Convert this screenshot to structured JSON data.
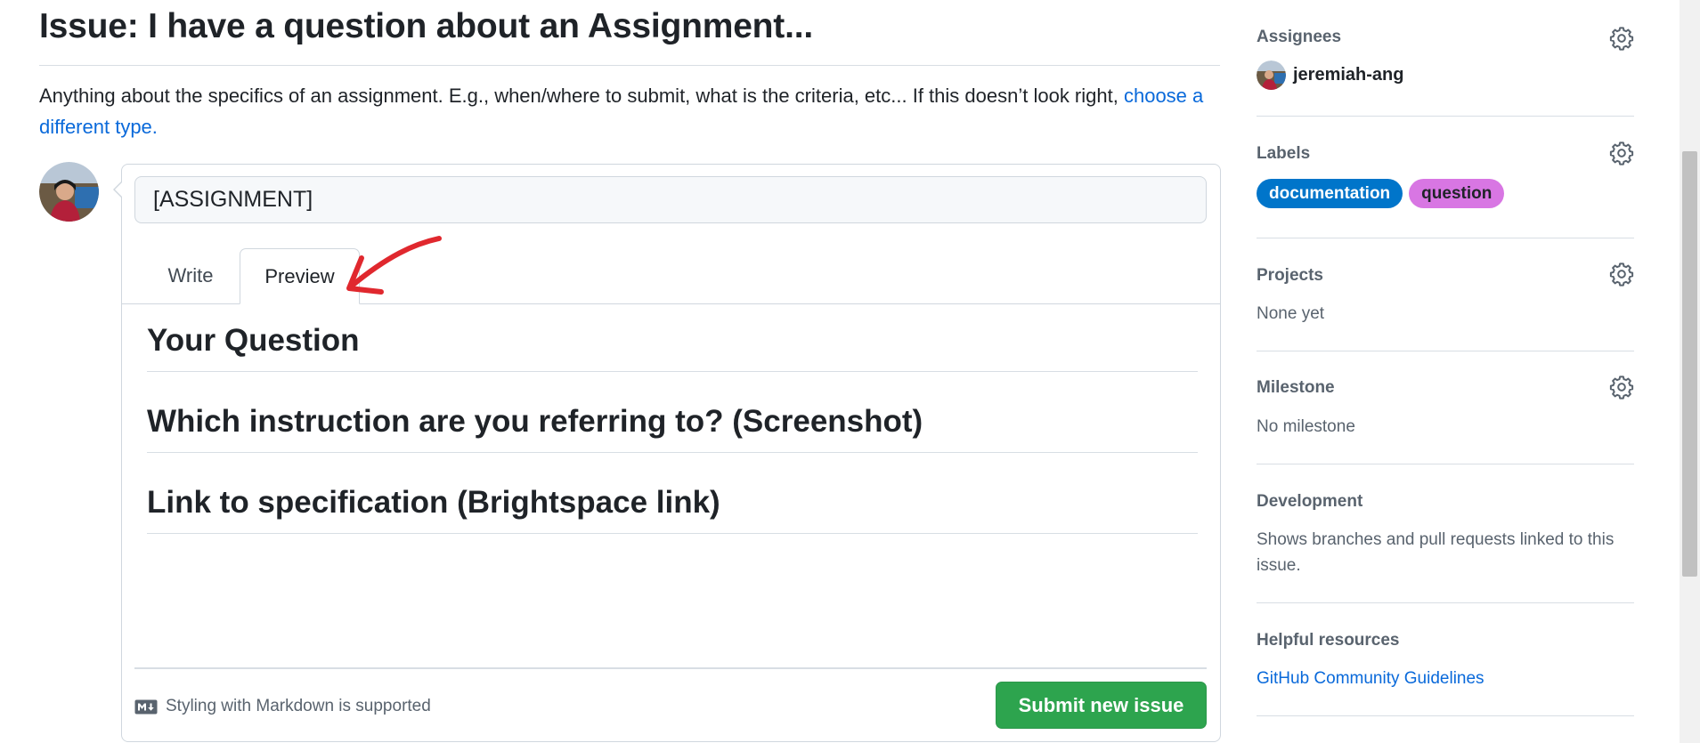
{
  "issue": {
    "title": "Issue: I have a question about an Assignment...",
    "description": "Anything about the specifics of an assignment. E.g., when/where to submit, what is the criteria, etc... If this doesn’t look right,",
    "change_type_link": "choose a different type."
  },
  "composer": {
    "title_value": "[ASSIGNMENT]",
    "tabs": [
      {
        "label": "Write",
        "selected": false
      },
      {
        "label": "Preview",
        "selected": true
      }
    ],
    "preview_headings": [
      "Your Question",
      "Which instruction are you referring to? (Screenshot)",
      "Link to specification (Brightspace link)"
    ],
    "markdown_note": "Styling with Markdown is supported",
    "submit_label": "Submit new issue"
  },
  "sidebar": {
    "assignees": {
      "heading": "Assignees",
      "user": "jeremiah-ang"
    },
    "labels": {
      "heading": "Labels",
      "items": [
        {
          "name": "documentation",
          "bg": "#0075ca",
          "fg": "#ffffff"
        },
        {
          "name": "question",
          "bg": "#d876e3",
          "fg": "#1f2328"
        }
      ]
    },
    "projects": {
      "heading": "Projects",
      "value": "None yet"
    },
    "milestone": {
      "heading": "Milestone",
      "value": "No milestone"
    },
    "development": {
      "heading": "Development",
      "value": "Shows branches and pull requests linked to this issue."
    },
    "helpful": {
      "heading": "Helpful resources",
      "link": "GitHub Community Guidelines"
    }
  },
  "colors": {
    "accent_link": "#0969da",
    "submit_green": "#2da44e",
    "annotation_red": "#e0282e"
  },
  "icons": [
    "gear-icon",
    "markdown-icon",
    "avatar"
  ]
}
